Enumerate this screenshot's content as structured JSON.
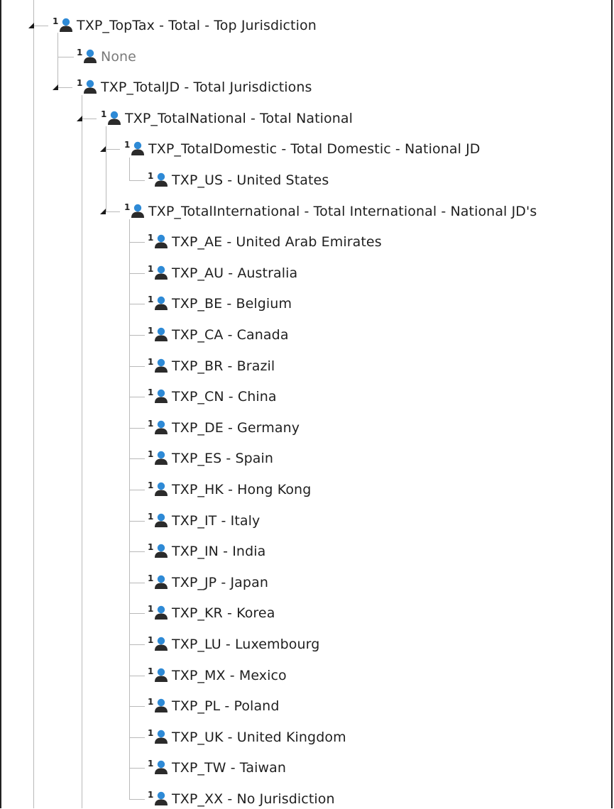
{
  "tree": {
    "icon": "member-icon",
    "colors": {
      "person_head": "#2e8ad6",
      "person_body": "#2b2b2b",
      "connector": "#b9b9b9",
      "text": "#1f1f1f",
      "muted_text": "#7a7a7a"
    },
    "nodes": [
      {
        "key": "toptax",
        "label": "TXP_TopTax - Total - Top Jurisdiction",
        "level": 1,
        "expanded": true
      },
      {
        "key": "none",
        "label": "None",
        "level": 2,
        "muted": true
      },
      {
        "key": "totaljd",
        "label": "TXP_TotalJD - Total Jurisdictions",
        "level": 2,
        "expanded": true
      },
      {
        "key": "totalnational",
        "label": "TXP_TotalNational - Total National",
        "level": 3,
        "expanded": true
      },
      {
        "key": "totaldomestic",
        "label": "TXP_TotalDomestic - Total Domestic - National JD",
        "level": 4,
        "expanded": true
      },
      {
        "key": "us",
        "label": "TXP_US - United States",
        "level": 5
      },
      {
        "key": "totalinternational",
        "label": "TXP_TotalInternational - Total International - National JD's",
        "level": 4,
        "expanded": true
      },
      {
        "key": "ae",
        "label": "TXP_AE - United Arab Emirates",
        "level": 5
      },
      {
        "key": "au",
        "label": "TXP_AU - Australia",
        "level": 5
      },
      {
        "key": "be",
        "label": "TXP_BE - Belgium",
        "level": 5
      },
      {
        "key": "ca",
        "label": "TXP_CA - Canada",
        "level": 5
      },
      {
        "key": "br",
        "label": "TXP_BR - Brazil",
        "level": 5
      },
      {
        "key": "cn",
        "label": "TXP_CN - China",
        "level": 5
      },
      {
        "key": "de",
        "label": "TXP_DE - Germany",
        "level": 5
      },
      {
        "key": "es",
        "label": "TXP_ES - Spain",
        "level": 5
      },
      {
        "key": "hk",
        "label": "TXP_HK - Hong Kong",
        "level": 5
      },
      {
        "key": "it",
        "label": "TXP_IT - Italy",
        "level": 5
      },
      {
        "key": "in",
        "label": "TXP_IN - India",
        "level": 5
      },
      {
        "key": "jp",
        "label": "TXP_JP - Japan",
        "level": 5
      },
      {
        "key": "kr",
        "label": "TXP_KR - Korea",
        "level": 5
      },
      {
        "key": "lu",
        "label": "TXP_LU - Luxembourg",
        "level": 5
      },
      {
        "key": "mx",
        "label": "TXP_MX - Mexico",
        "level": 5
      },
      {
        "key": "pl",
        "label": "TXP_PL - Poland",
        "level": 5
      },
      {
        "key": "uk",
        "label": "TXP_UK - United Kingdom",
        "level": 5
      },
      {
        "key": "tw",
        "label": "TXP_TW - Taiwan",
        "level": 5
      },
      {
        "key": "xx",
        "label": "TXP_XX - No Jurisdiction",
        "level": 5
      }
    ]
  }
}
